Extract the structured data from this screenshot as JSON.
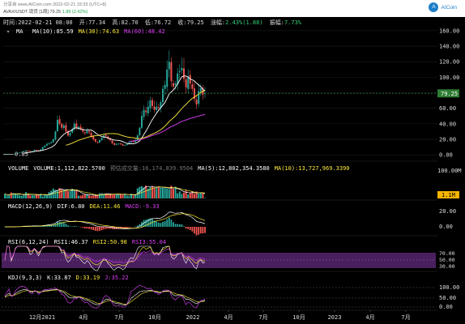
{
  "header": {
    "line1": "分享自 www.AICoin.com  2022-02-21 15:33 (UTC+8)",
    "pair": "AVAX/USDT 现货 [1周] ",
    "price": "79.25",
    "change": "1.89 (2.42%)",
    "logo": "AICoin"
  },
  "info_line": {
    "time_label": "时间:",
    "time": "2022-02-21 08:00",
    "open_label": "开:",
    "open": "77.34",
    "high_label": "高:",
    "high": "82.70",
    "low_label": "低:",
    "low": "76.72",
    "close_label": "收:",
    "close": "79.25",
    "change_label": "涨幅:",
    "change": "2.43%(1.88)",
    "amp_label": "振幅:",
    "amp": "7.73%"
  },
  "chart_data": [
    {
      "type": "candlestick",
      "title": "MA",
      "legend": [
        {
          "text": "MA(10):85.59",
          "color": "#ffffff"
        },
        {
          "text": "MA(30):74.63",
          "color": "#ffeb3b"
        },
        {
          "text": "MA(60):48.42",
          "color": "#e040fb"
        }
      ],
      "y_ticks": [
        0,
        20,
        40,
        60,
        80,
        100,
        120,
        140,
        160
      ],
      "y_tick_labels": [
        "0.00",
        "20.00",
        "40.00",
        "60.00",
        "80.00",
        "100.00",
        "120.00",
        "140.00",
        "160.00"
      ],
      "ylim": [
        -5,
        163
      ],
      "last_price": 79.25,
      "last_price_label": "79.25",
      "low_marker": 0.85,
      "low_marker_label": "0.85",
      "weekly_closes": [
        0.9,
        1.0,
        1.2,
        0.95,
        1.1,
        1.6,
        2.5,
        3.0,
        4.0,
        5.0,
        5.8,
        5.2,
        4.5,
        4.8,
        6.5,
        6.0,
        5.5,
        7.0,
        10.0,
        12.0,
        14.0,
        15.0,
        16.5,
        20.0,
        30.0,
        45.0,
        40.0,
        35.0,
        38.0,
        30.0,
        25.0,
        28.0,
        33.0,
        40.0,
        35.0,
        36.0,
        33.0,
        30.0,
        28.0,
        31.0,
        29.0,
        24.0,
        20.0,
        17.0,
        16.0,
        19.0,
        22.0,
        25.0,
        24.0,
        21.0,
        19.0,
        15.0,
        13.0,
        14.0,
        14.5,
        13.5,
        12.0,
        12.5,
        14.0,
        16.0,
        17.0,
        16.5,
        19.0,
        25.0,
        35.0,
        50.0,
        58.0,
        55.0,
        62.0,
        70.0,
        63.0,
        58.0,
        62.0,
        60.0,
        68.0,
        85.0,
        90.0,
        110.0,
        120.0,
        95.0,
        88.0,
        92.0,
        105.0,
        108.0,
        112.0,
        98.0,
        87.0,
        100.0,
        92.0,
        85.0,
        72.0,
        65.0,
        82.0,
        86.0,
        77.3,
        79.25
      ]
    },
    {
      "type": "bar",
      "title": "VOLUME",
      "legend": [
        {
          "text": "VOLUME:1,112,822.5700",
          "color": "#ffffff"
        },
        {
          "text": "预估成交量:16,174,839.9504",
          "color": "#777777"
        },
        {
          "text": "MA(5):12,802,354.3580",
          "color": "#ffffff"
        },
        {
          "text": "MA(10):13,727,969.3390",
          "color": "#ffeb3b"
        }
      ],
      "y_tick_label": "100.00M",
      "last_label": "1.1M"
    },
    {
      "type": "line",
      "title": "MACD(12,26,9)",
      "legend": [
        {
          "text": "DIF:6.80",
          "color": "#ffffff"
        },
        {
          "text": "DEA:11.46",
          "color": "#ffeb3b"
        },
        {
          "text": "MACD:-9.33",
          "color": "#e040fb"
        }
      ],
      "y_tick_labels": [
        "20.00",
        "0.00"
      ]
    },
    {
      "type": "line",
      "title": "RSI(6,12,24)",
      "legend": [
        {
          "text": "RSI1:46.37",
          "color": "#ffffff"
        },
        {
          "text": "RSI2:50.98",
          "color": "#ffeb3b"
        },
        {
          "text": "RSI3:55.04",
          "color": "#e040fb"
        }
      ],
      "y_tick_labels": [
        "70.00",
        "50.00",
        "30.00"
      ]
    },
    {
      "type": "line",
      "title": "KDJ(9,3,3)",
      "legend": [
        {
          "text": "K:33.87",
          "color": "#ffffff"
        },
        {
          "text": "D:33.19",
          "color": "#ffeb3b"
        },
        {
          "text": "J:35.22",
          "color": "#e040fb"
        }
      ],
      "y_tick_labels": [
        "100.00",
        "50.00",
        "0.00"
      ]
    }
  ],
  "x_axis_labels": [
    "12月2021",
    "4月",
    "7月",
    "10月",
    "2022",
    "4月",
    "7月",
    "10月",
    "2023",
    "4月",
    "7月"
  ],
  "colors": {
    "up": "#26a69a",
    "down": "#ef5350",
    "ma10": "#ffffff",
    "ma30": "#ffeb3b",
    "ma60": "#e040fb",
    "price_line": "#2e7d32"
  }
}
